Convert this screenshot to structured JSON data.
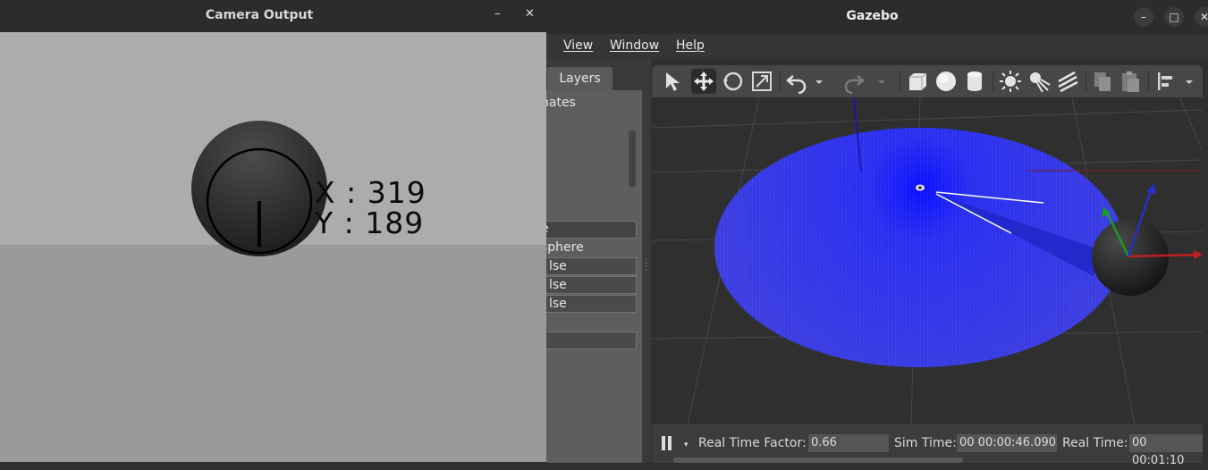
{
  "gazebo": {
    "title": "Gazebo",
    "window_controls": {
      "minimize": "–",
      "maximize": "□",
      "close": "✕"
    },
    "menu": [
      "View",
      "Window",
      "Help"
    ],
    "left_panel": {
      "tab_label": "Layers",
      "text_coordinates": "nates",
      "rows": [
        "e",
        "sphere",
        "lse",
        "lse",
        "lse"
      ]
    },
    "toolbar_icons": [
      "select-arrow-icon",
      "translate-icon",
      "rotate-icon",
      "scale-icon",
      "undo-icon",
      "dropdown-icon",
      "redo-icon",
      "dropdown-icon",
      "box-icon",
      "sphere-icon",
      "cylinder-icon",
      "point-light-icon",
      "spot-light-icon",
      "directional-light-icon",
      "copy-icon",
      "paste-icon",
      "align-icon",
      "dropdown-icon"
    ],
    "status": {
      "rtf_label": "Real Time Factor:",
      "rtf_value": "0.66",
      "sim_label": "Sim Time:",
      "sim_value": "00 00:00:46.090",
      "real_label": "Real Time:",
      "real_value": "00 00:01:10"
    }
  },
  "camera": {
    "title": "Camera Output",
    "minimize": "–",
    "close": "✕",
    "x_text": "X : 319",
    "y_text": "Y : 189"
  },
  "colors": {
    "laser": "#2b2bff",
    "axis_x": "#d01c1c",
    "axis_y": "#1fa12a",
    "axis_z": "#2a3bd6"
  }
}
